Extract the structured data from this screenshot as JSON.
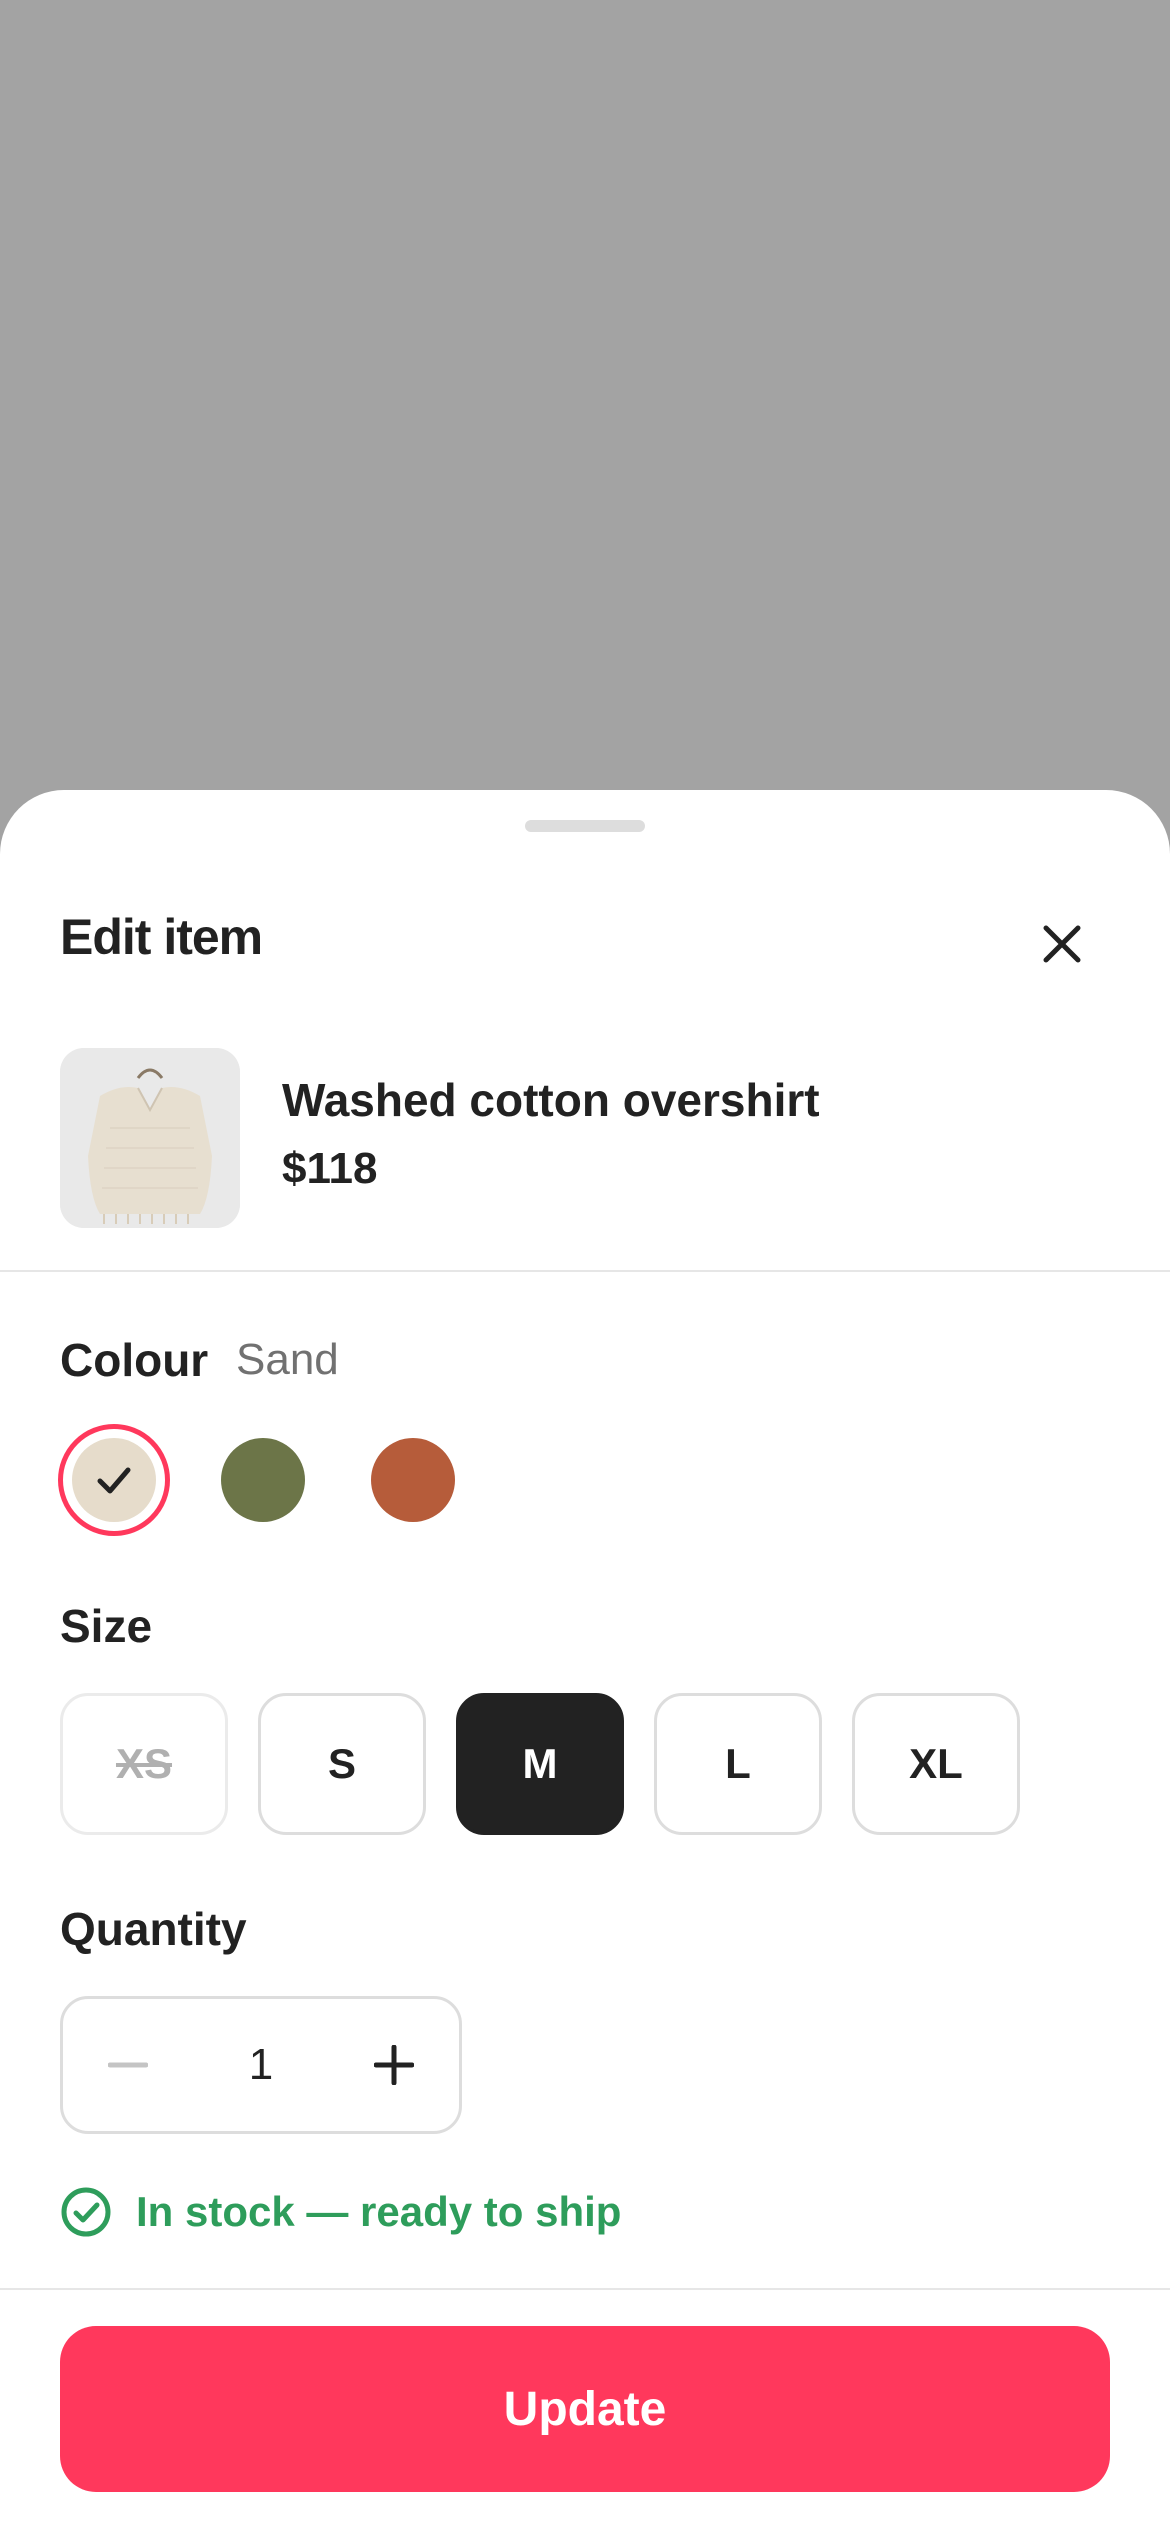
{
  "sheet": {
    "title": "Edit item"
  },
  "product": {
    "name": "Washed cotton overshirt",
    "price": "$118",
    "image_icon": "sweater-photo"
  },
  "colour": {
    "label": "Colour",
    "selected_name": "Sand",
    "swatches": [
      {
        "name": "Sand",
        "color": "#e6dccb",
        "selected": true
      },
      {
        "name": "Olive",
        "color": "#6c7548",
        "selected": false
      },
      {
        "name": "Rust",
        "color": "#b65c3a",
        "selected": false
      }
    ]
  },
  "size": {
    "label": "Size",
    "options": [
      {
        "label": "XS",
        "state": "unavailable"
      },
      {
        "label": "S",
        "state": "available"
      },
      {
        "label": "M",
        "state": "selected"
      },
      {
        "label": "L",
        "state": "available"
      },
      {
        "label": "XL",
        "state": "available"
      }
    ]
  },
  "quantity": {
    "label": "Quantity",
    "value": "1"
  },
  "stock": {
    "text": "In stock — ready to ship",
    "color": "#2e9d5b"
  },
  "actions": {
    "update_label": "Update"
  },
  "colors": {
    "accent": "#ff385c",
    "text": "#222222",
    "muted": "#717171",
    "backdrop": "#a3a3a3"
  }
}
